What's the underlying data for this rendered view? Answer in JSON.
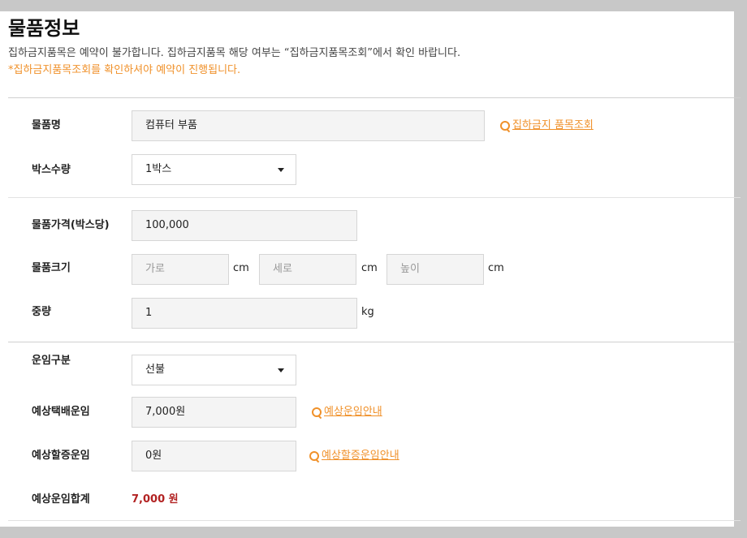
{
  "header": {
    "title": "물품정보",
    "description": "집하금지품목은 예약이 불가합니다. 집하금지품목 해당 여부는 “집하금지품목조회”에서 확인 바랍니다.",
    "notice": "*집하금지품목조회를 확인하셔야 예약이 진행됩니다."
  },
  "item_name": {
    "label": "물품명",
    "value": "컴퓨터 부품",
    "link_label": "집하금지 품목조회"
  },
  "box_count": {
    "label": "박스수량",
    "selected": "1박스"
  },
  "item_price": {
    "label": "물품가격(박스당)",
    "value": "100,000"
  },
  "item_size": {
    "label": "물품크기",
    "width_placeholder": "가로",
    "length_placeholder": "세로",
    "height_placeholder": "높이",
    "unit": "cm"
  },
  "weight": {
    "label": "중량",
    "value": "1",
    "unit": "kg"
  },
  "fare_type": {
    "label": "운임구분",
    "selected": "선불"
  },
  "expected_fare": {
    "label": "예상택배운임",
    "value": "7,000원",
    "link_label": "예상운임안내"
  },
  "surcharge": {
    "label": "예상할증운임",
    "value": "0원",
    "link_label": "예상할증운임안내"
  },
  "total": {
    "label": "예상운임합계",
    "value": "7,000 원"
  },
  "icons": {
    "search": "magnifier",
    "dropdown": "caret-down"
  },
  "colors": {
    "accent_orange": "#f0912a",
    "total_red": "#b22222",
    "field_bg": "#f4f4f4",
    "page_bg": "#c8c8c8"
  }
}
